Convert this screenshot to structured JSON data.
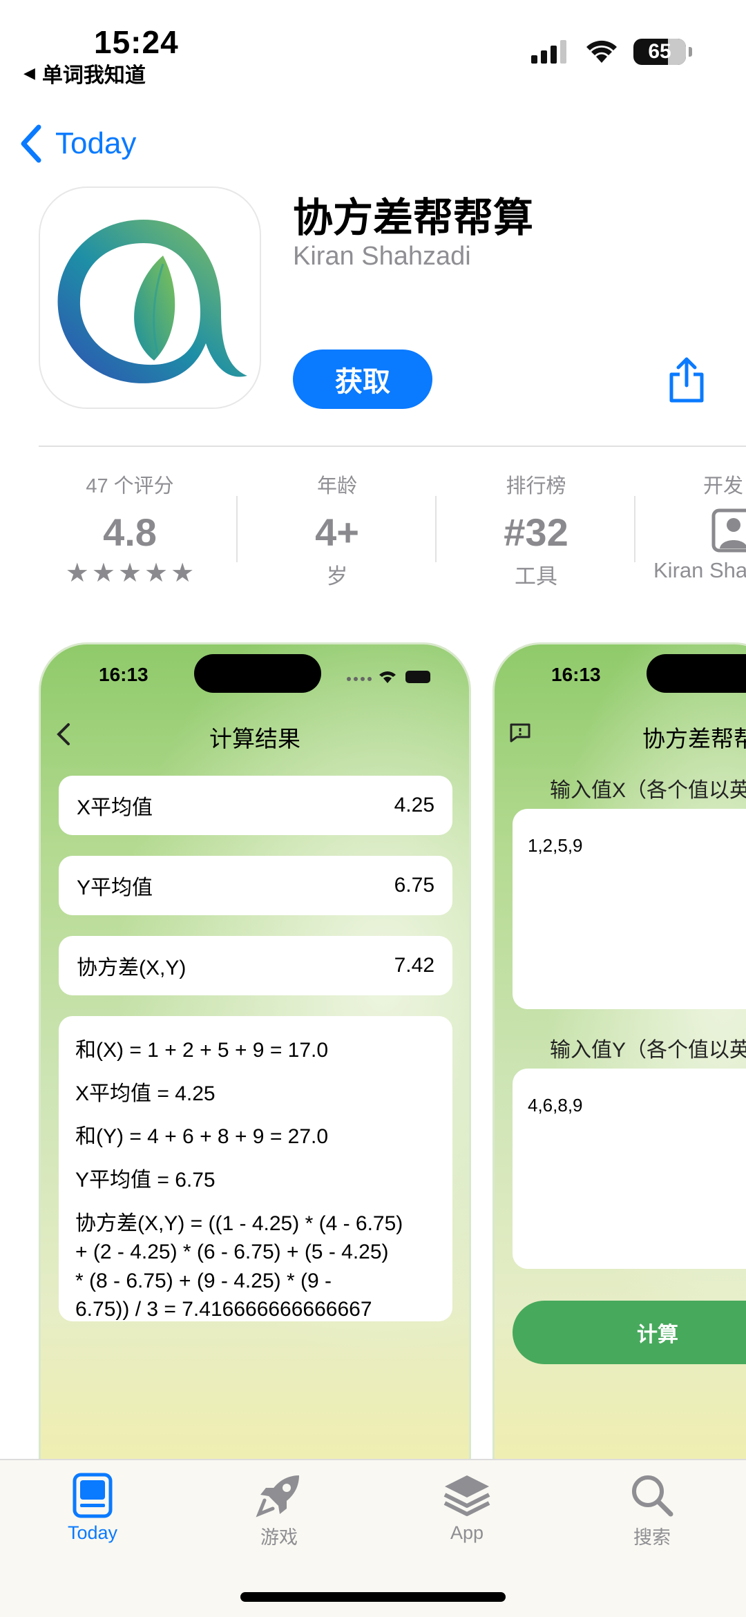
{
  "status_bar": {
    "time": "15:24",
    "back_app": "单词我知道",
    "battery": "65"
  },
  "nav": {
    "back_label": "Today"
  },
  "app": {
    "title": "协方差帮帮算",
    "developer": "Kiran Shahzadi",
    "get_label": "获取"
  },
  "stats": [
    {
      "label": "47 个评分",
      "value": "4.8",
      "stars": 5
    },
    {
      "label": "年龄",
      "value": "4+",
      "sub": "岁"
    },
    {
      "label": "排行榜",
      "value": "#32",
      "sub": "工具"
    },
    {
      "label": "开发",
      "sub": "Kiran Sha"
    }
  ],
  "screenshot1": {
    "time": "16:13",
    "title": "计算结果",
    "rows": [
      {
        "label": "X平均值",
        "value": "4.25"
      },
      {
        "label": "Y平均值",
        "value": "6.75"
      },
      {
        "label": "协方差(X,Y)",
        "value": "7.42"
      }
    ],
    "calc_lines": [
      "和(X) = 1 + 2 + 5 + 9 = 17.0",
      "X平均值 = 4.25",
      "和(Y) = 4 + 6 + 8 + 9 = 27.0",
      "Y平均值 = 6.75",
      "协方差(X,Y) = ((1 - 4.25) * (4 - 6.75)\n+ (2 - 4.25) * (6 - 6.75) + (5 - 4.25)\n* (8 - 6.75) + (9 - 4.25) * (9 -\n6.75)) / 3 = 7.416666666666667"
    ]
  },
  "screenshot2": {
    "time": "16:13",
    "title": "协方差帮帮",
    "input_x_label": "输入值X（各个值以英",
    "input_x_value": "1,2,5,9",
    "input_y_label": "输入值Y（各个值以英",
    "input_y_value": "4,6,8,9",
    "button": "计算"
  },
  "tabs": [
    {
      "label": "Today",
      "icon": "today-icon",
      "active": true
    },
    {
      "label": "游戏",
      "icon": "rocket-icon"
    },
    {
      "label": "App",
      "icon": "layers-icon"
    },
    {
      "label": "搜索",
      "icon": "search-icon"
    }
  ],
  "colors": {
    "accent": "#0a7aff",
    "calc_button": "#47a95c"
  }
}
